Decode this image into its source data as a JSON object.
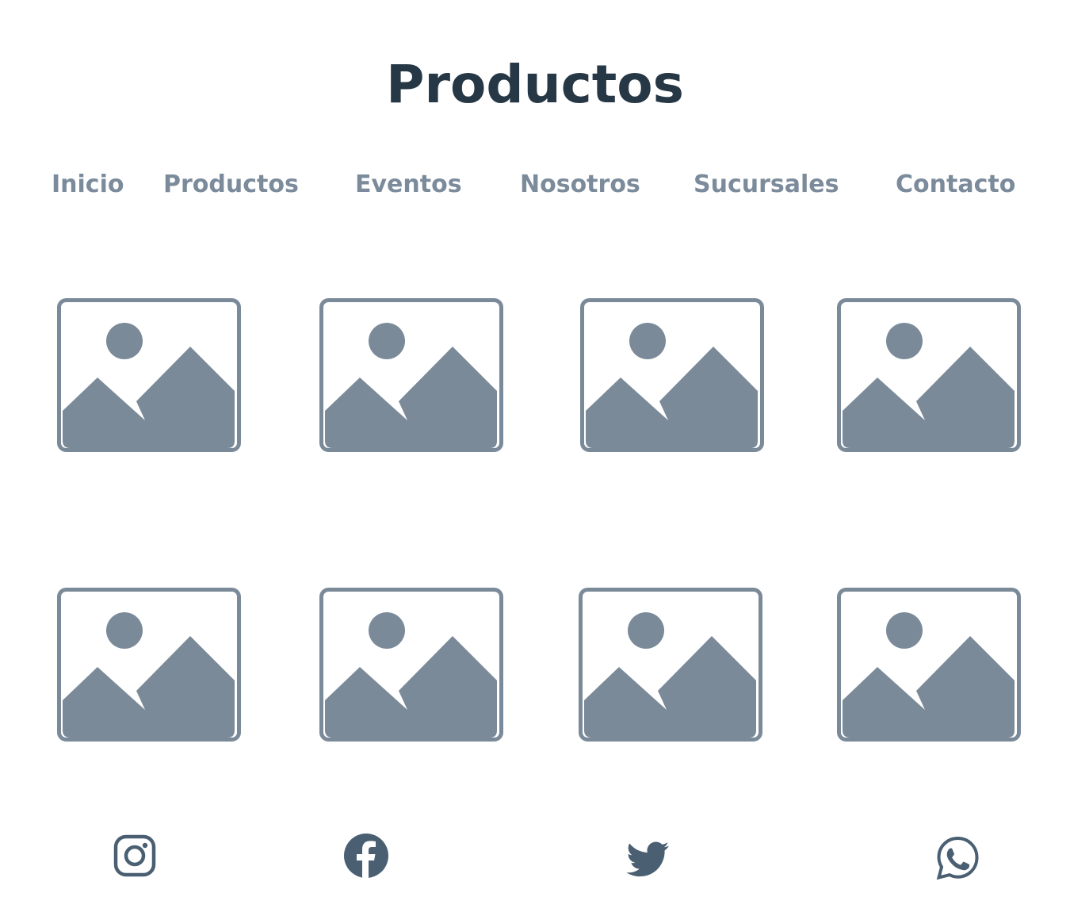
{
  "header": {
    "title": "Productos"
  },
  "nav": {
    "items": [
      {
        "label": "Inicio"
      },
      {
        "label": "Productos"
      },
      {
        "label": "Eventos"
      },
      {
        "label": "Nosotros"
      },
      {
        "label": "Sucursales"
      },
      {
        "label": "Contacto"
      }
    ]
  },
  "gallery": {
    "placeholder_icon": "image-placeholder-icon",
    "count": 8
  },
  "social": {
    "icons": [
      "instagram-icon",
      "facebook-icon",
      "twitter-icon",
      "whatsapp-icon"
    ]
  },
  "colors": {
    "title": "#263746",
    "nav": "#7b8b9b",
    "placeholder": "#7b8a99",
    "social": "#4a5f72"
  }
}
